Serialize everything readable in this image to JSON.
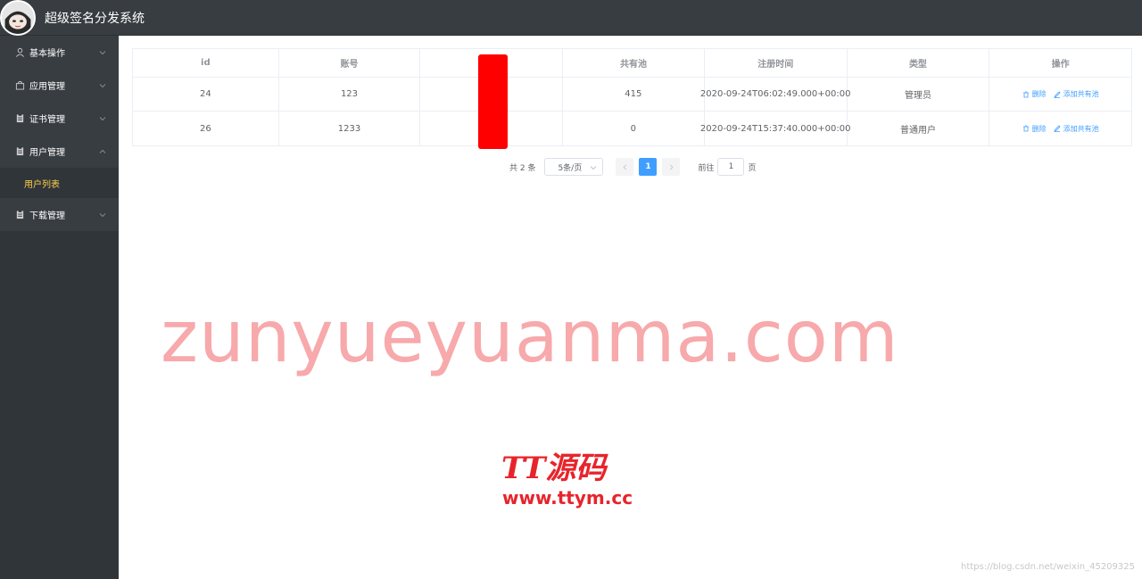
{
  "header": {
    "title": "超级签名分发系统"
  },
  "sidebar": {
    "items": [
      {
        "label": "基本操作",
        "icon": "user-icon",
        "expanded": false
      },
      {
        "label": "应用管理",
        "icon": "bag-icon",
        "expanded": false
      },
      {
        "label": "证书管理",
        "icon": "clipboard-icon",
        "expanded": false
      },
      {
        "label": "用户管理",
        "icon": "clipboard-icon",
        "expanded": true
      },
      {
        "label": "下载管理",
        "icon": "clipboard-icon",
        "expanded": false
      }
    ],
    "subitem": {
      "label": "用户列表",
      "active_color": "#ffd04b"
    }
  },
  "table": {
    "columns": [
      "id",
      "账号",
      "",
      "共有池",
      "注册时间",
      "类型",
      "操作"
    ],
    "rows": [
      {
        "id": "24",
        "account": "123",
        "hidden": "",
        "pool": "415",
        "registered": "2020-09-24T06:02:49.000+00:00",
        "type": "管理员"
      },
      {
        "id": "26",
        "account": "1233",
        "hidden": "",
        "pool": "0",
        "registered": "2020-09-24T15:37:40.000+00:00",
        "type": "普通用户"
      }
    ],
    "actions": {
      "delete": "删除",
      "add_pool": "添加共有池"
    }
  },
  "pagination": {
    "total": "共 2 条",
    "page_size": "5条/页",
    "current": "1",
    "goto_label": "前往",
    "goto_value": "1",
    "page_suffix": "页"
  },
  "watermarks": {
    "main": "zunyueyuanma.com",
    "logo": "TT源码",
    "url": "www.ttym.cc",
    "corner": "https://blog.csdn.net/weixin_45209325"
  },
  "colors": {
    "header_bg": "#373d41",
    "sidebar_bg": "#30353a",
    "accent": "#409eff",
    "active_menu": "#ffd04b",
    "watermark": "#f7a9ab",
    "logo_red": "#e8242b"
  }
}
